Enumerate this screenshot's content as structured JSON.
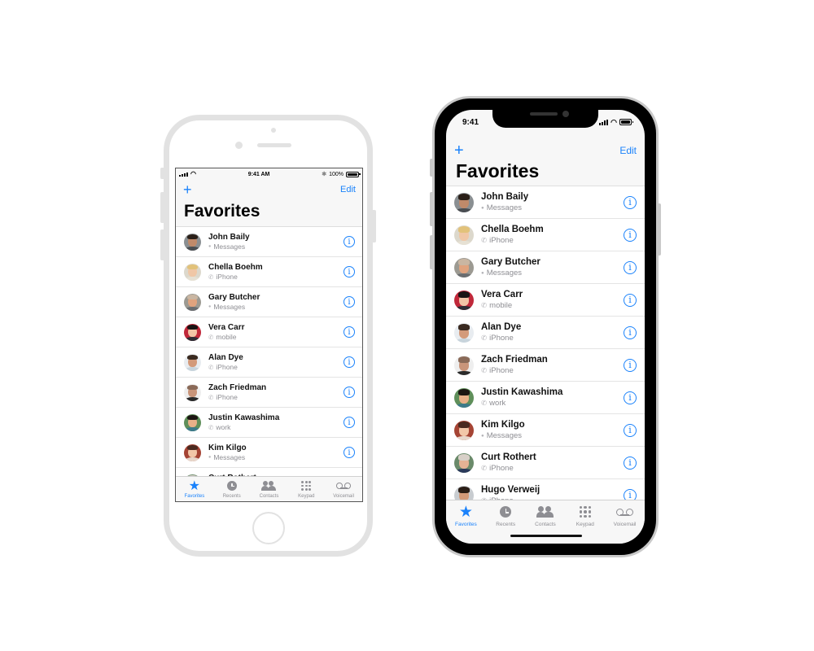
{
  "status_bar_small": {
    "time": "9:41 AM",
    "battery": "100%",
    "battery_level": 1.0,
    "bluetooth_icon": "bluetooth-icon"
  },
  "status_bar_large": {
    "time": "9:41",
    "battery_level": 1.0
  },
  "navbar": {
    "add_icon": "+",
    "edit_label": "Edit",
    "title": "Favorites"
  },
  "colors": {
    "accent": "#1a82fb",
    "secondary_text": "#8e8e93",
    "inactive_tab": "#8e8e93"
  },
  "favorites": [
    {
      "name": "John Baily",
      "type": "Messages",
      "type_icon": "message-bubble-icon",
      "avatar": {
        "bg": "#8a8f92",
        "skin": "#c08a6a",
        "hair": "#2a1f18",
        "shirt": "#4a4e52"
      }
    },
    {
      "name": "Chella Boehm",
      "type": "iPhone",
      "type_icon": "phone-icon",
      "avatar": {
        "bg": "#dcd8cc",
        "skin": "#f0c7a6",
        "hair": "#e2c27a",
        "shirt": "#e6e1d4"
      }
    },
    {
      "name": "Gary Butcher",
      "type": "Messages",
      "type_icon": "message-bubble-icon",
      "avatar": {
        "bg": "#9c9a92",
        "skin": "#e0a37e",
        "hair": "#c9b6a2",
        "shirt": "#6a6d70"
      }
    },
    {
      "name": "Vera Carr",
      "type": "mobile",
      "type_icon": "phone-icon",
      "avatar": {
        "bg": "#c0283a",
        "skin": "#f2c4a6",
        "hair": "#1a1414",
        "shirt": "#2d2d35"
      }
    },
    {
      "name": "Alan Dye",
      "type": "iPhone",
      "type_icon": "phone-icon",
      "avatar": {
        "bg": "#e8ecf0",
        "skin": "#d39a7a",
        "hair": "#3a2a20",
        "shirt": "#c8d4dc"
      }
    },
    {
      "name": "Zach Friedman",
      "type": "iPhone",
      "type_icon": "phone-icon",
      "avatar": {
        "bg": "#eeeeee",
        "skin": "#c9957a",
        "hair": "#8a6a58",
        "shirt": "#2a2a2a"
      }
    },
    {
      "name": "Justin Kawashima",
      "type": "work",
      "type_icon": "phone-icon",
      "avatar": {
        "bg": "#5f8f5a",
        "skin": "#e8b088",
        "hair": "#1c1612",
        "shirt": "#3d7a8a"
      }
    },
    {
      "name": "Kim Kilgo",
      "type": "Messages",
      "type_icon": "message-bubble-icon",
      "avatar": {
        "bg": "#a54434",
        "skin": "#f2c7a8",
        "hair": "#4a2a20",
        "shirt": "#e8d8cc"
      }
    },
    {
      "name": "Curt Rothert",
      "type": "iPhone",
      "type_icon": "phone-icon",
      "avatar": {
        "bg": "#6a8a6a",
        "skin": "#e4b294",
        "hair": "#d8d0c8",
        "shirt": "#2a3a5a"
      }
    },
    {
      "name": "Hugo Verweij",
      "type": "iPhone",
      "type_icon": "phone-icon",
      "avatar": {
        "bg": "#c8ccd0",
        "skin": "#d29a78",
        "hair": "#2a1e16",
        "shirt": "#1a1a1a"
      }
    }
  ],
  "tabs": [
    {
      "label": "Favorites",
      "icon": "star-icon",
      "active": true
    },
    {
      "label": "Recents",
      "icon": "clock-icon",
      "active": false
    },
    {
      "label": "Contacts",
      "icon": "contacts-icon",
      "active": false
    },
    {
      "label": "Keypad",
      "icon": "keypad-icon",
      "active": false
    },
    {
      "label": "Voicemail",
      "icon": "voicemail-icon",
      "active": false
    }
  ]
}
